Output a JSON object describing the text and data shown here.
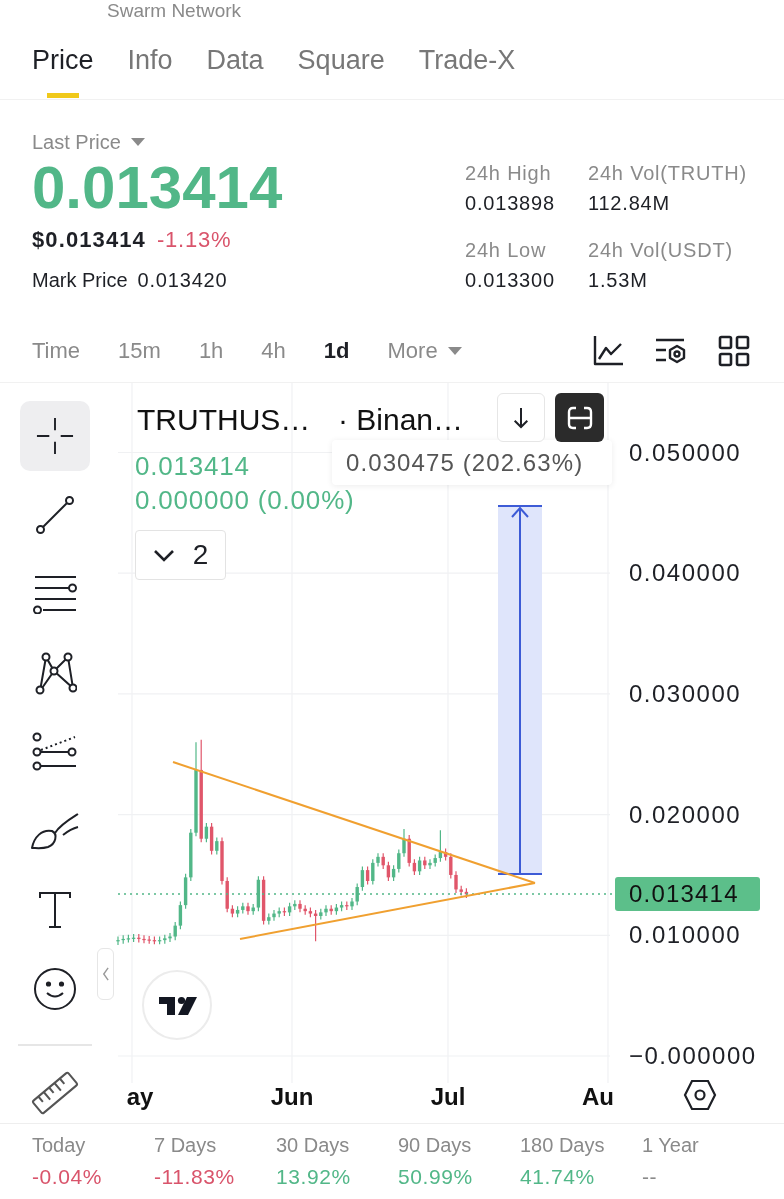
{
  "header": {
    "title": "Swarm Network"
  },
  "tabs": [
    {
      "label": "Price",
      "selected": true
    },
    {
      "label": "Info",
      "selected": false
    },
    {
      "label": "Data",
      "selected": false
    },
    {
      "label": "Square",
      "selected": false
    },
    {
      "label": "Trade-X",
      "selected": false
    }
  ],
  "ticker": {
    "last_price_label": "Last Price",
    "price": "0.013414",
    "usd_price": "$0.013414",
    "change": "-1.13%",
    "mark_price_label": "Mark Price",
    "mark_price": "0.013420",
    "stats": [
      {
        "label": "24h High",
        "value": "0.013898"
      },
      {
        "label": "24h Vol(TRUTH)",
        "value": "112.84M"
      },
      {
        "label": "24h Low",
        "value": "0.013300"
      },
      {
        "label": "24h Vol(USDT)",
        "value": "1.53M"
      }
    ]
  },
  "intervals": [
    {
      "label": "Time",
      "kind": "option",
      "selected": false
    },
    {
      "label": "15m",
      "kind": "option",
      "selected": false
    },
    {
      "label": "1h",
      "kind": "option",
      "selected": false
    },
    {
      "label": "4h",
      "kind": "option",
      "selected": false
    },
    {
      "label": "1d",
      "kind": "option",
      "selected": true
    },
    {
      "label": "More",
      "kind": "menu",
      "selected": false
    }
  ],
  "drawing_tools": [
    {
      "kind": "crosshair",
      "selected": true
    },
    {
      "kind": "trend_line",
      "selected": false
    },
    {
      "kind": "parallel_lines",
      "selected": false
    },
    {
      "kind": "pattern",
      "selected": false
    },
    {
      "kind": "fib",
      "selected": false
    },
    {
      "kind": "brush",
      "selected": false
    },
    {
      "kind": "text",
      "selected": false
    },
    {
      "kind": "emoji",
      "selected": false
    },
    {
      "kind": "ruler",
      "selected": false
    }
  ],
  "chart": {
    "symbol": "TRUTHUS…",
    "exchange": "· Binan…",
    "last": "0.013414",
    "change": "0.000000 (0.00%)",
    "indicator_count": "2",
    "measure": "0.030475 (202.63%)",
    "price_tag": "0.013414",
    "y_axis": [
      "0.050000",
      "0.040000",
      "0.030000",
      "0.020000",
      "0.010000",
      "−0.000000"
    ],
    "x_axis": [
      "ay",
      "Jun",
      "Jul",
      "Au"
    ]
  },
  "performance": [
    {
      "label": "Today",
      "value": "-0.04%",
      "color": "#d9546b"
    },
    {
      "label": "7 Days",
      "value": "-11.83%",
      "color": "#d9546b"
    },
    {
      "label": "30 Days",
      "value": "13.92%",
      "color": "#52b788"
    },
    {
      "label": "90 Days",
      "value": "50.99%",
      "color": "#52b788"
    },
    {
      "label": "180 Days",
      "value": "41.74%",
      "color": "#52b788"
    },
    {
      "label": "1 Year",
      "value": "--",
      "color": "#8a8a8a"
    }
  ]
}
